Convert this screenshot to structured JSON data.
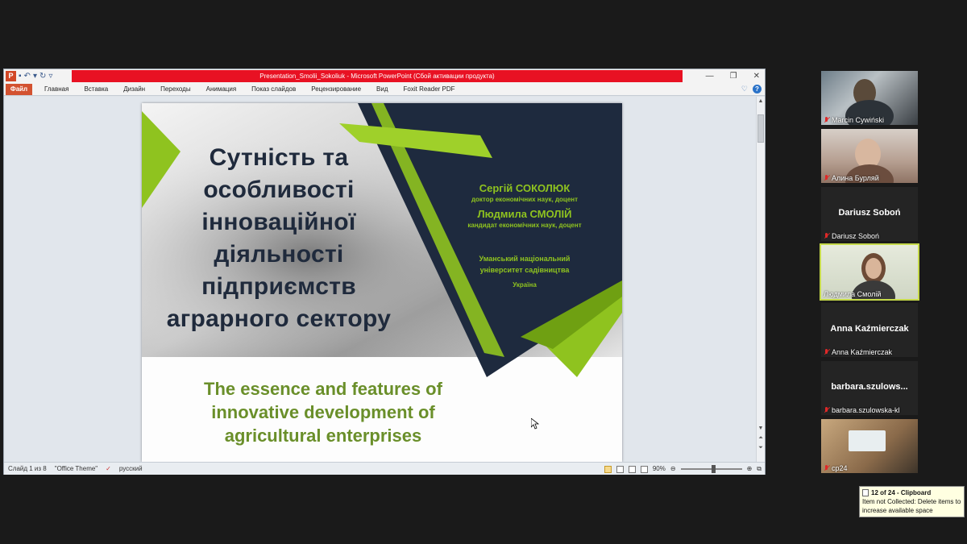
{
  "window": {
    "title": "Presentation_Smolii_Sokoliuk  -  Microsoft PowerPoint (Сбой активации продукта)",
    "minimize": "—",
    "restore": "❐",
    "close": "✕"
  },
  "ribbon": {
    "file_tab": "Файл",
    "tabs": [
      "Главная",
      "Вставка",
      "Дизайн",
      "Переходы",
      "Анимация",
      "Показ слайдов",
      "Рецензирование",
      "Вид",
      "Foxit Reader PDF"
    ]
  },
  "slide": {
    "title_uk": [
      "Сутність та",
      "особливості",
      "інноваційної",
      "діяльності",
      "підприємств",
      "аграрного сектору"
    ],
    "author1_name": "Сергій СОКОЛЮК",
    "author1_degree": "доктор економічних наук, доцент",
    "author2_name": "Людмила СМОЛІЙ",
    "author2_degree": "кандидат економічних наук, доцент",
    "university": [
      "Уманський національний",
      "університет садівництва"
    ],
    "country": "Україна",
    "title_en": [
      "The essence and features of",
      "innovative development of",
      "agricultural enterprises"
    ],
    "colors": {
      "green": "#8fc31f",
      "navy": "#1e2a3e",
      "title": "#1f2a3c",
      "en_title": "#6a8f2a"
    }
  },
  "statusbar": {
    "slide_info": "Слайд 1 из 8",
    "theme": "\"Office Theme\"",
    "language": "русский",
    "zoom": "90%"
  },
  "participants": [
    {
      "name": "Marcin Cywiński",
      "muted": true,
      "video": true
    },
    {
      "name": "Алина Бурляй",
      "muted": true,
      "video": true
    },
    {
      "name": "Dariusz Soboń",
      "big_name": "Dariusz Soboń",
      "muted": true,
      "video": false
    },
    {
      "name": "Людмила Смолій",
      "muted": false,
      "video": true,
      "active_speaker": true
    },
    {
      "name": "Anna Kaźmierczak",
      "big_name": "Anna Kaźmierczak",
      "muted": true,
      "video": false
    },
    {
      "name": "barbara.szulowska-kl",
      "big_name": "barbara.szulows...",
      "muted": true,
      "video": false
    },
    {
      "name": "cp24",
      "muted": true,
      "video": true
    }
  ],
  "clipboard": {
    "header": "12 of 24 - Clipboard",
    "message": "Item not Collected: Delete items to increase available space"
  }
}
